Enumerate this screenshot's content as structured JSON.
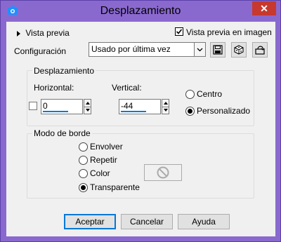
{
  "window": {
    "title": "Desplazamiento",
    "close_glyph": "✕",
    "icon": "camera-icon"
  },
  "preview": {
    "toggle_label": "Vista previa",
    "image_checkbox_label": "Vista previa en imagen",
    "image_checked": true
  },
  "config": {
    "label": "Configuración",
    "selected": "Usado por última vez",
    "icons": [
      "save-preset-icon",
      "randomize-icon",
      "reset-icon"
    ]
  },
  "displacement": {
    "group_title": "Desplazamiento",
    "horizontal_label": "Horizontal:",
    "horizontal_value": "0",
    "vertical_label": "Vertical:",
    "vertical_value": "-44",
    "link_checked": false,
    "center_label": "Centro",
    "custom_label": "Personalizado",
    "selected": "custom"
  },
  "edge_mode": {
    "group_title": "Modo de borde",
    "options": [
      "Envolver",
      "Repetir",
      "Color",
      "Transparente"
    ],
    "selected": "Transparente",
    "color_icon": "no-color-icon"
  },
  "buttons": {
    "ok": "Aceptar",
    "cancel": "Cancelar",
    "help": "Ayuda"
  }
}
